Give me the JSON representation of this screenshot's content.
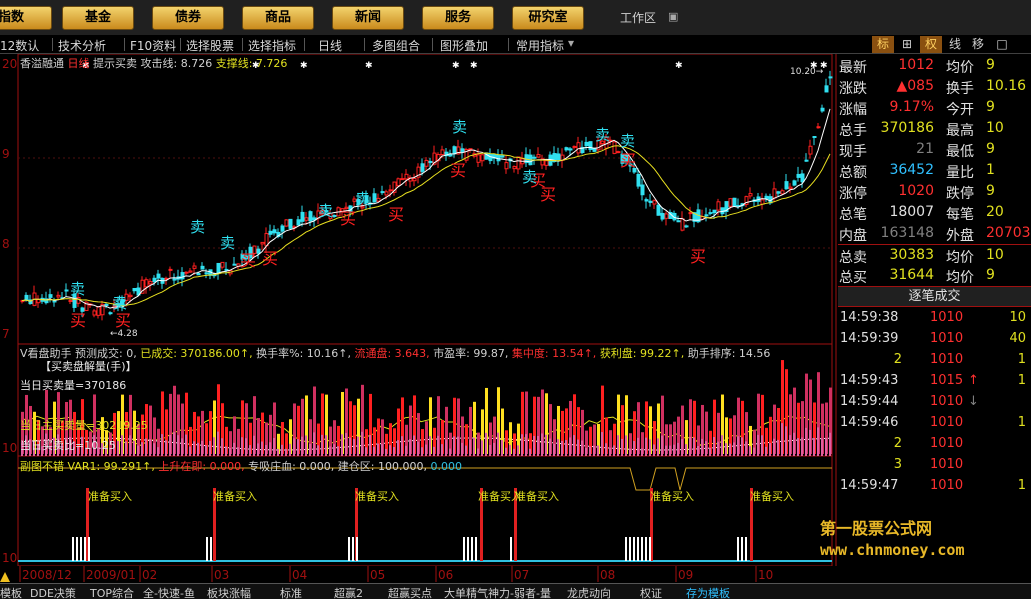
{
  "nav": {
    "buttons": [
      "指数",
      "基金",
      "债券",
      "商品",
      "新闻",
      "服务",
      "研究室"
    ],
    "workspace": "工作区"
  },
  "toolbar": {
    "items": [
      "12数认",
      "技术分析",
      "F10资料",
      "选择股票",
      "选择指标",
      "日线",
      "多图组合",
      "图形叠加",
      "常用指标"
    ],
    "right": [
      "标",
      "⊞",
      "权",
      "线",
      "移",
      "□"
    ]
  },
  "main_chart": {
    "title": "香溢融通",
    "period": "日线",
    "indicator": "提示买卖",
    "attack_label": "攻击线: 8.726",
    "support_label": "支撑线: 7.726",
    "y_ticks": [
      "20",
      "9",
      "8",
      "7"
    ],
    "low_label": "4.28",
    "high_label": "10.20",
    "buy_label": "买",
    "sell_label": "卖"
  },
  "vol_panel": {
    "header_parts": [
      "V看盘助手 预测成交: 0,",
      "已成交: 370186.00↑,",
      "换手率%: 10.16↑,",
      "流通盘: 3.643,",
      "市盈率: 99.87,",
      "集中度: 13.54↑,",
      "获利盘: 99.22↑,",
      "助手排序: 14.56"
    ],
    "section_title": "【买卖盘解量(手)】",
    "day_vol": "当日买卖量=370186",
    "main_buy": "当日主买卖量=30219.25",
    "ratio": "当日买卖比=10.25"
  },
  "sub_panel": {
    "header_parts": [
      "副图不错 VAR1: 99.291↑,",
      "上升在即: 0.000,",
      "专吸庄血: 0.000,",
      "建仓区: 100.000,",
      "0.000"
    ],
    "signal_label": "准备买入",
    "signal_label_alt": "准备买入",
    "cut_label": "准备买入"
  },
  "x_axis": [
    "2008/12",
    "2009/01",
    "02",
    "03",
    "04",
    "05",
    "06",
    "07",
    "08",
    "09",
    "10"
  ],
  "quote": {
    "rows": [
      {
        "l1": "最新",
        "v1": "1012",
        "l2": "均价",
        "v2": "9"
      },
      {
        "l1": "涨跌",
        "v1": "▲085",
        "l2": "换手",
        "v2": "10.16"
      },
      {
        "l1": "涨幅",
        "v1": "9.17%",
        "l2": "今开",
        "v2": "9"
      },
      {
        "l1": "总手",
        "v1": "370186",
        "l2": "最高",
        "v2": "10"
      },
      {
        "l1": "现手",
        "v1": "21",
        "l2": "最低",
        "v2": "9"
      },
      {
        "l1": "总额",
        "v1": "36452",
        "l2": "量比",
        "v2": "1"
      },
      {
        "l1": "涨停",
        "v1": "1020",
        "l2": "跌停",
        "v2": "9"
      },
      {
        "l1": "总笔",
        "v1": "18007",
        "l2": "每笔",
        "v2": "20"
      },
      {
        "l1": "内盘",
        "v1": "163148",
        "l2": "外盘",
        "v2": "20703"
      },
      {
        "l1": "总卖",
        "v1": "30383",
        "l2": "均价",
        "v2": "10"
      },
      {
        "l1": "总买",
        "v1": "31644",
        "l2": "均价",
        "v2": "9"
      }
    ]
  },
  "ticks": {
    "title": "逐笔成交",
    "rows": [
      {
        "time": "14:59:38",
        "price": "1010",
        "vol": "10"
      },
      {
        "time": "14:59:39",
        "price": "1010",
        "vol": "40"
      },
      {
        "time": "",
        "price": "1010",
        "vol": "1",
        "count": "2"
      },
      {
        "time": "14:59:43",
        "price": "1015",
        "vol": "1",
        "arrow": "up"
      },
      {
        "time": "14:59:44",
        "price": "1010",
        "vol": "",
        "arrow": "down"
      },
      {
        "time": "14:59:46",
        "price": "1010",
        "vol": "1"
      },
      {
        "time": "",
        "price": "1010",
        "vol": "",
        "count": "2"
      },
      {
        "time": "",
        "price": "1010",
        "vol": "",
        "count": "3"
      },
      {
        "time": "14:59:47",
        "price": "1010",
        "vol": "1"
      }
    ]
  },
  "bottom_tabs": [
    "模板",
    "DDE决策",
    "TOP综合",
    "全-快速-鱼",
    "板块涨幅",
    "标准",
    "超赢2",
    "超赢买点",
    "大单精气神力-弱者-量",
    "龙虎动向",
    "权证",
    "存为模板"
  ],
  "watermark": {
    "line1": "第一股票公式网",
    "line2": "www.chnmoney.com"
  },
  "colors": {
    "up": "#ff2020",
    "down": "#30e0f0",
    "ma_white": "#ffffff",
    "ma_yellow": "#e8e020",
    "accent": "#e8b828"
  }
}
